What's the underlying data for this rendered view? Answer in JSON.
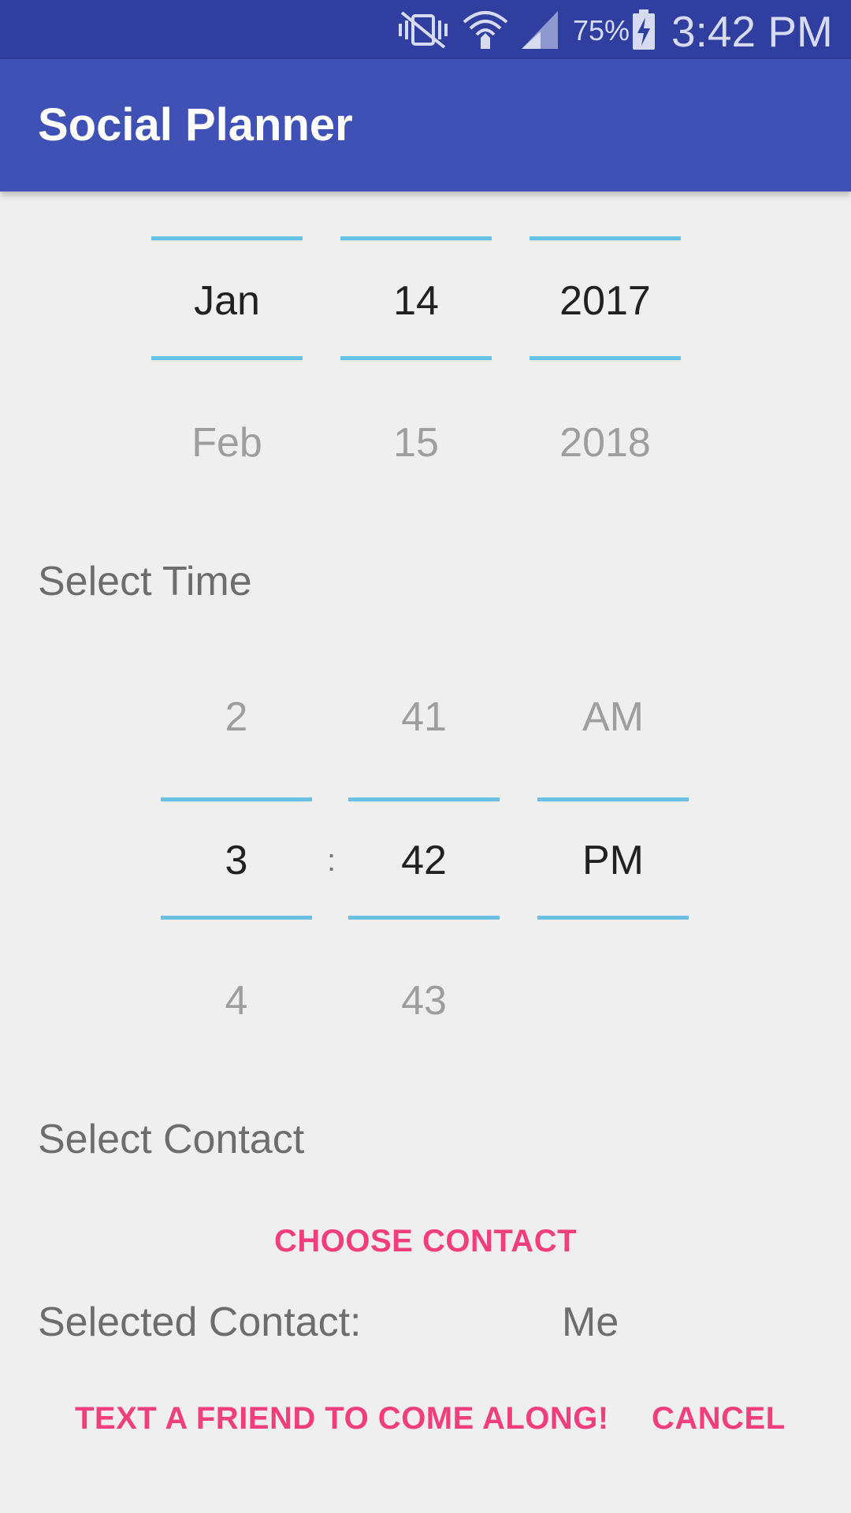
{
  "status_bar": {
    "battery": "75%",
    "time": "3:42 PM",
    "icons": [
      "vibrate-off-icon",
      "wifi-icon",
      "signal-icon",
      "battery-charging-icon"
    ]
  },
  "app_bar": {
    "title": "Social Planner"
  },
  "date_picker": {
    "month": {
      "selected": "Jan",
      "next": "Feb"
    },
    "day": {
      "selected": "14",
      "next": "15"
    },
    "year": {
      "selected": "2017",
      "next": "2018"
    }
  },
  "time_section": {
    "label": "Select Time",
    "hour": {
      "prev": "2",
      "selected": "3",
      "next": "4"
    },
    "separator": ":",
    "minute": {
      "prev": "41",
      "selected": "42",
      "next": "43"
    },
    "ampm": {
      "prev": "AM",
      "selected": "PM"
    }
  },
  "contact_section": {
    "label": "Select Contact",
    "choose_button": "CHOOSE CONTACT",
    "selected_label": "Selected Contact:",
    "selected_value": "Me"
  },
  "actions": {
    "text_friend": "TEXT A FRIEND TO COME ALONG!",
    "cancel": "CANCEL"
  },
  "colors": {
    "status_bar": "#303f9f",
    "app_bar": "#3f51b5",
    "accent": "#f13f7d",
    "picker_divider": "#6cc0e4",
    "background": "#efefef"
  }
}
